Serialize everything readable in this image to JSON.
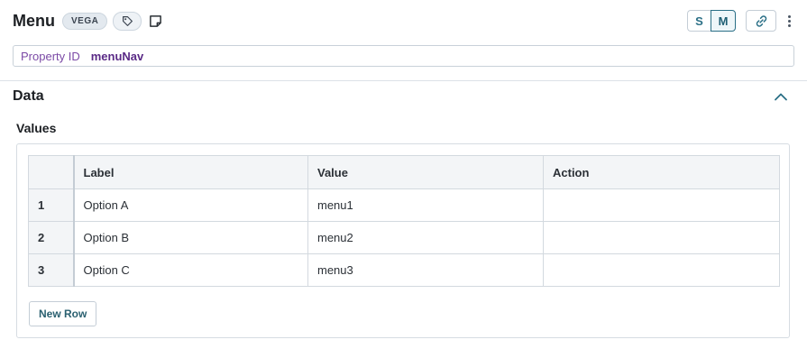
{
  "header": {
    "title": "Menu",
    "badge": "VEGA"
  },
  "size_toggle": {
    "small": "S",
    "medium": "M",
    "selected": "M"
  },
  "property": {
    "label": "Property ID",
    "value": "menuNav"
  },
  "section": {
    "title": "Data",
    "expanded": true
  },
  "values": {
    "label": "Values",
    "columns": [
      "Label",
      "Value",
      "Action"
    ],
    "rows": [
      {
        "index": "1",
        "label": "Option A",
        "value": "menu1",
        "action": ""
      },
      {
        "index": "2",
        "label": "Option B",
        "value": "menu2",
        "action": ""
      },
      {
        "index": "3",
        "label": "Option C",
        "value": "menu3",
        "action": ""
      }
    ],
    "new_row_label": "New Row"
  },
  "colors": {
    "accent": "#2a6f86",
    "property_label": "#7b4aa6",
    "property_value": "#5a2a86"
  }
}
